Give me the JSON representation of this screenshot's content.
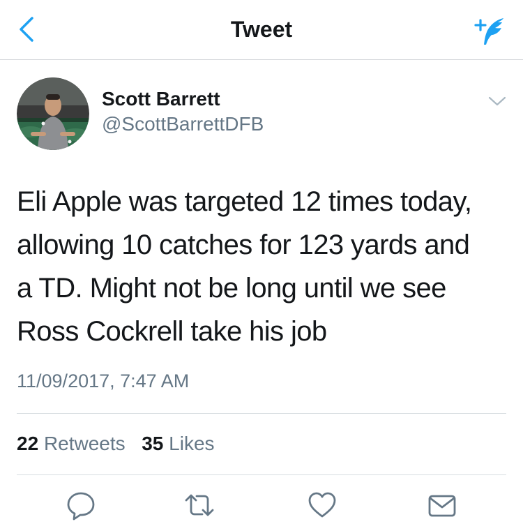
{
  "nav": {
    "title": "Tweet",
    "back_icon": "chevron-left-icon",
    "compose_icon": "compose-tweet-icon",
    "accent_color": "#1da1f2"
  },
  "tweet": {
    "author": {
      "name": "Scott Barrett",
      "handle": "@ScottBarrettDFB"
    },
    "text_lines": [
      "Eli Apple was targeted 12 times today,",
      "allowing 10 catches for 123 yards and",
      "a TD. Might not be long until we see",
      "Ross Cockrell take his job"
    ],
    "timestamp": "11/09/2017, 7:47 AM",
    "stats": {
      "retweets_count": "22",
      "retweets_label": "Retweets",
      "likes_count": "35",
      "likes_label": "Likes"
    }
  },
  "actions": [
    {
      "icon": "reply-icon"
    },
    {
      "icon": "retweet-icon"
    },
    {
      "icon": "like-icon"
    },
    {
      "icon": "direct-message-icon"
    }
  ],
  "colors": {
    "text": "#14171a",
    "secondary_text": "#657786",
    "divider": "#d8dde1"
  }
}
